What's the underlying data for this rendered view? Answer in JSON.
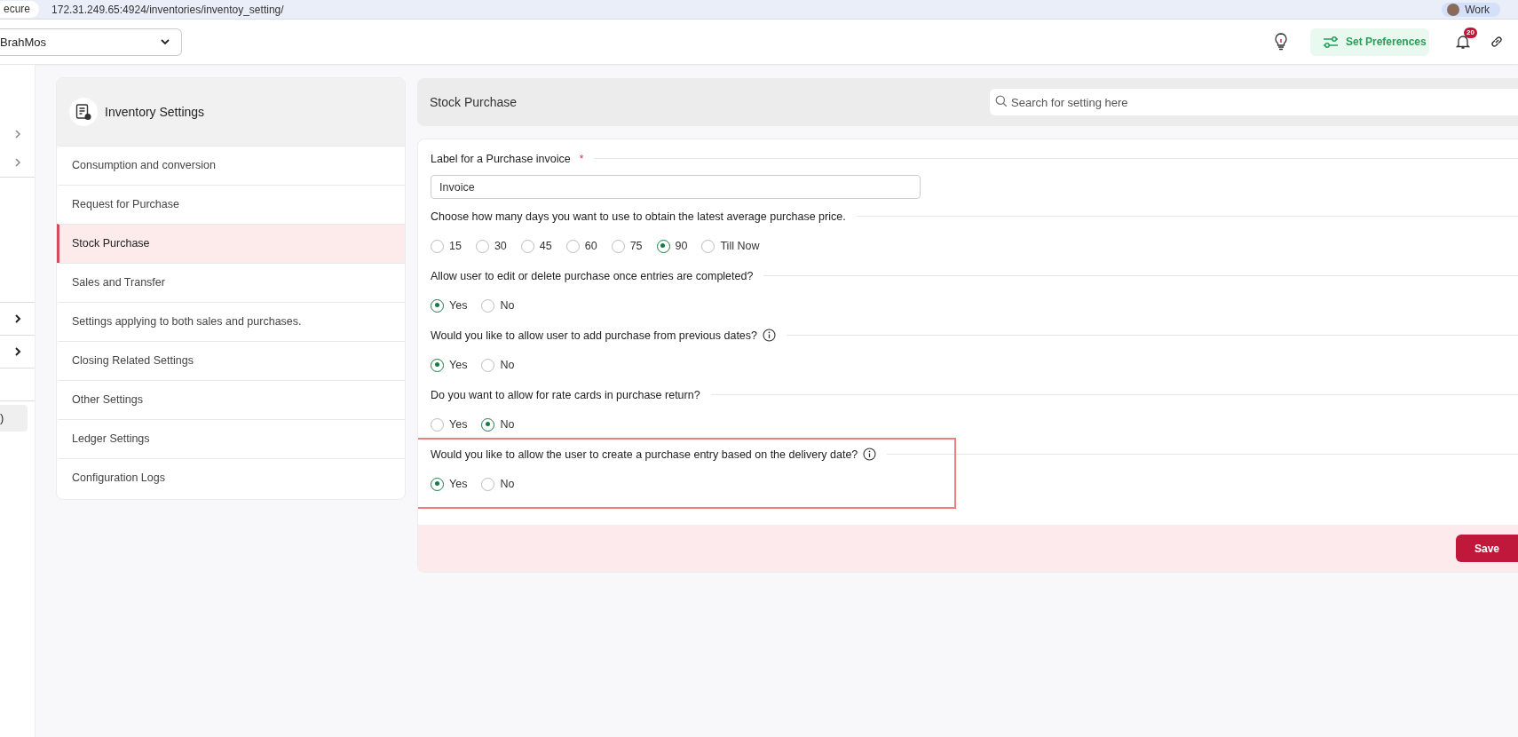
{
  "browser": {
    "security": "ecure",
    "url": "172.31.249.65:4924/inventories/inventoy_setting/",
    "profile": "Work"
  },
  "header": {
    "company": "BrahMos",
    "preferences_button": "Set Preferences",
    "notification_count": "20"
  },
  "left_nav": {
    "items": [
      {
        "kind": "chevron"
      },
      {
        "kind": "chevron"
      },
      {
        "kind": "divider"
      },
      {
        "kind": "spacer"
      },
      {
        "kind": "divider"
      },
      {
        "kind": "bold-chevron"
      },
      {
        "kind": "divider"
      },
      {
        "kind": "bold-chevron"
      },
      {
        "kind": "divider"
      },
      {
        "kind": "spacer-small"
      },
      {
        "kind": "divider"
      },
      {
        "kind": "pill",
        "label": ")"
      }
    ]
  },
  "settings_menu": {
    "title": "Inventory Settings",
    "items": [
      {
        "label": "Consumption and conversion",
        "selected": false
      },
      {
        "label": "Request for Purchase",
        "selected": false
      },
      {
        "label": "Stock Purchase",
        "selected": true
      },
      {
        "label": "Sales and Transfer",
        "selected": false
      },
      {
        "label": "Settings applying to both sales and purchases.",
        "selected": false
      },
      {
        "label": "Closing Related Settings",
        "selected": false
      },
      {
        "label": "Other Settings",
        "selected": false
      },
      {
        "label": "Ledger Settings",
        "selected": false
      },
      {
        "label": "Configuration Logs",
        "selected": false
      }
    ]
  },
  "panel": {
    "title": "Stock Purchase",
    "search": {
      "placeholder": "Search for setting here"
    },
    "settings": [
      {
        "kind": "text",
        "label": "Label for a Purchase invoice",
        "required": true,
        "required_mark": "*",
        "value": "Invoice"
      },
      {
        "kind": "radio",
        "label": "Choose how many days you want to use to obtain the latest average purchase price.",
        "info": false,
        "options": [
          {
            "label": "15",
            "selected": false
          },
          {
            "label": "30",
            "selected": false
          },
          {
            "label": "45",
            "selected": false
          },
          {
            "label": "60",
            "selected": false
          },
          {
            "label": "75",
            "selected": false
          },
          {
            "label": "90",
            "selected": true
          },
          {
            "label": "Till Now",
            "selected": false
          }
        ]
      },
      {
        "kind": "radio",
        "label": "Allow user to edit or delete purchase once entries are completed?",
        "info": false,
        "options": [
          {
            "label": "Yes",
            "selected": true
          },
          {
            "label": "No",
            "selected": false
          }
        ]
      },
      {
        "kind": "radio",
        "label": "Would you like to allow user to add purchase from previous dates?",
        "info": true,
        "options": [
          {
            "label": "Yes",
            "selected": true
          },
          {
            "label": "No",
            "selected": false
          }
        ]
      },
      {
        "kind": "radio",
        "label": "Do you want to allow for rate cards in purchase return?",
        "info": false,
        "options": [
          {
            "label": "Yes",
            "selected": false
          },
          {
            "label": "No",
            "selected": true
          }
        ]
      },
      {
        "kind": "radio",
        "label": "Would you like to allow the user to create a purchase entry based on the delivery date?",
        "info": true,
        "highlighted": true,
        "options": [
          {
            "label": "Yes",
            "selected": true
          },
          {
            "label": "No",
            "selected": false
          }
        ]
      }
    ],
    "save_button": "Save"
  }
}
